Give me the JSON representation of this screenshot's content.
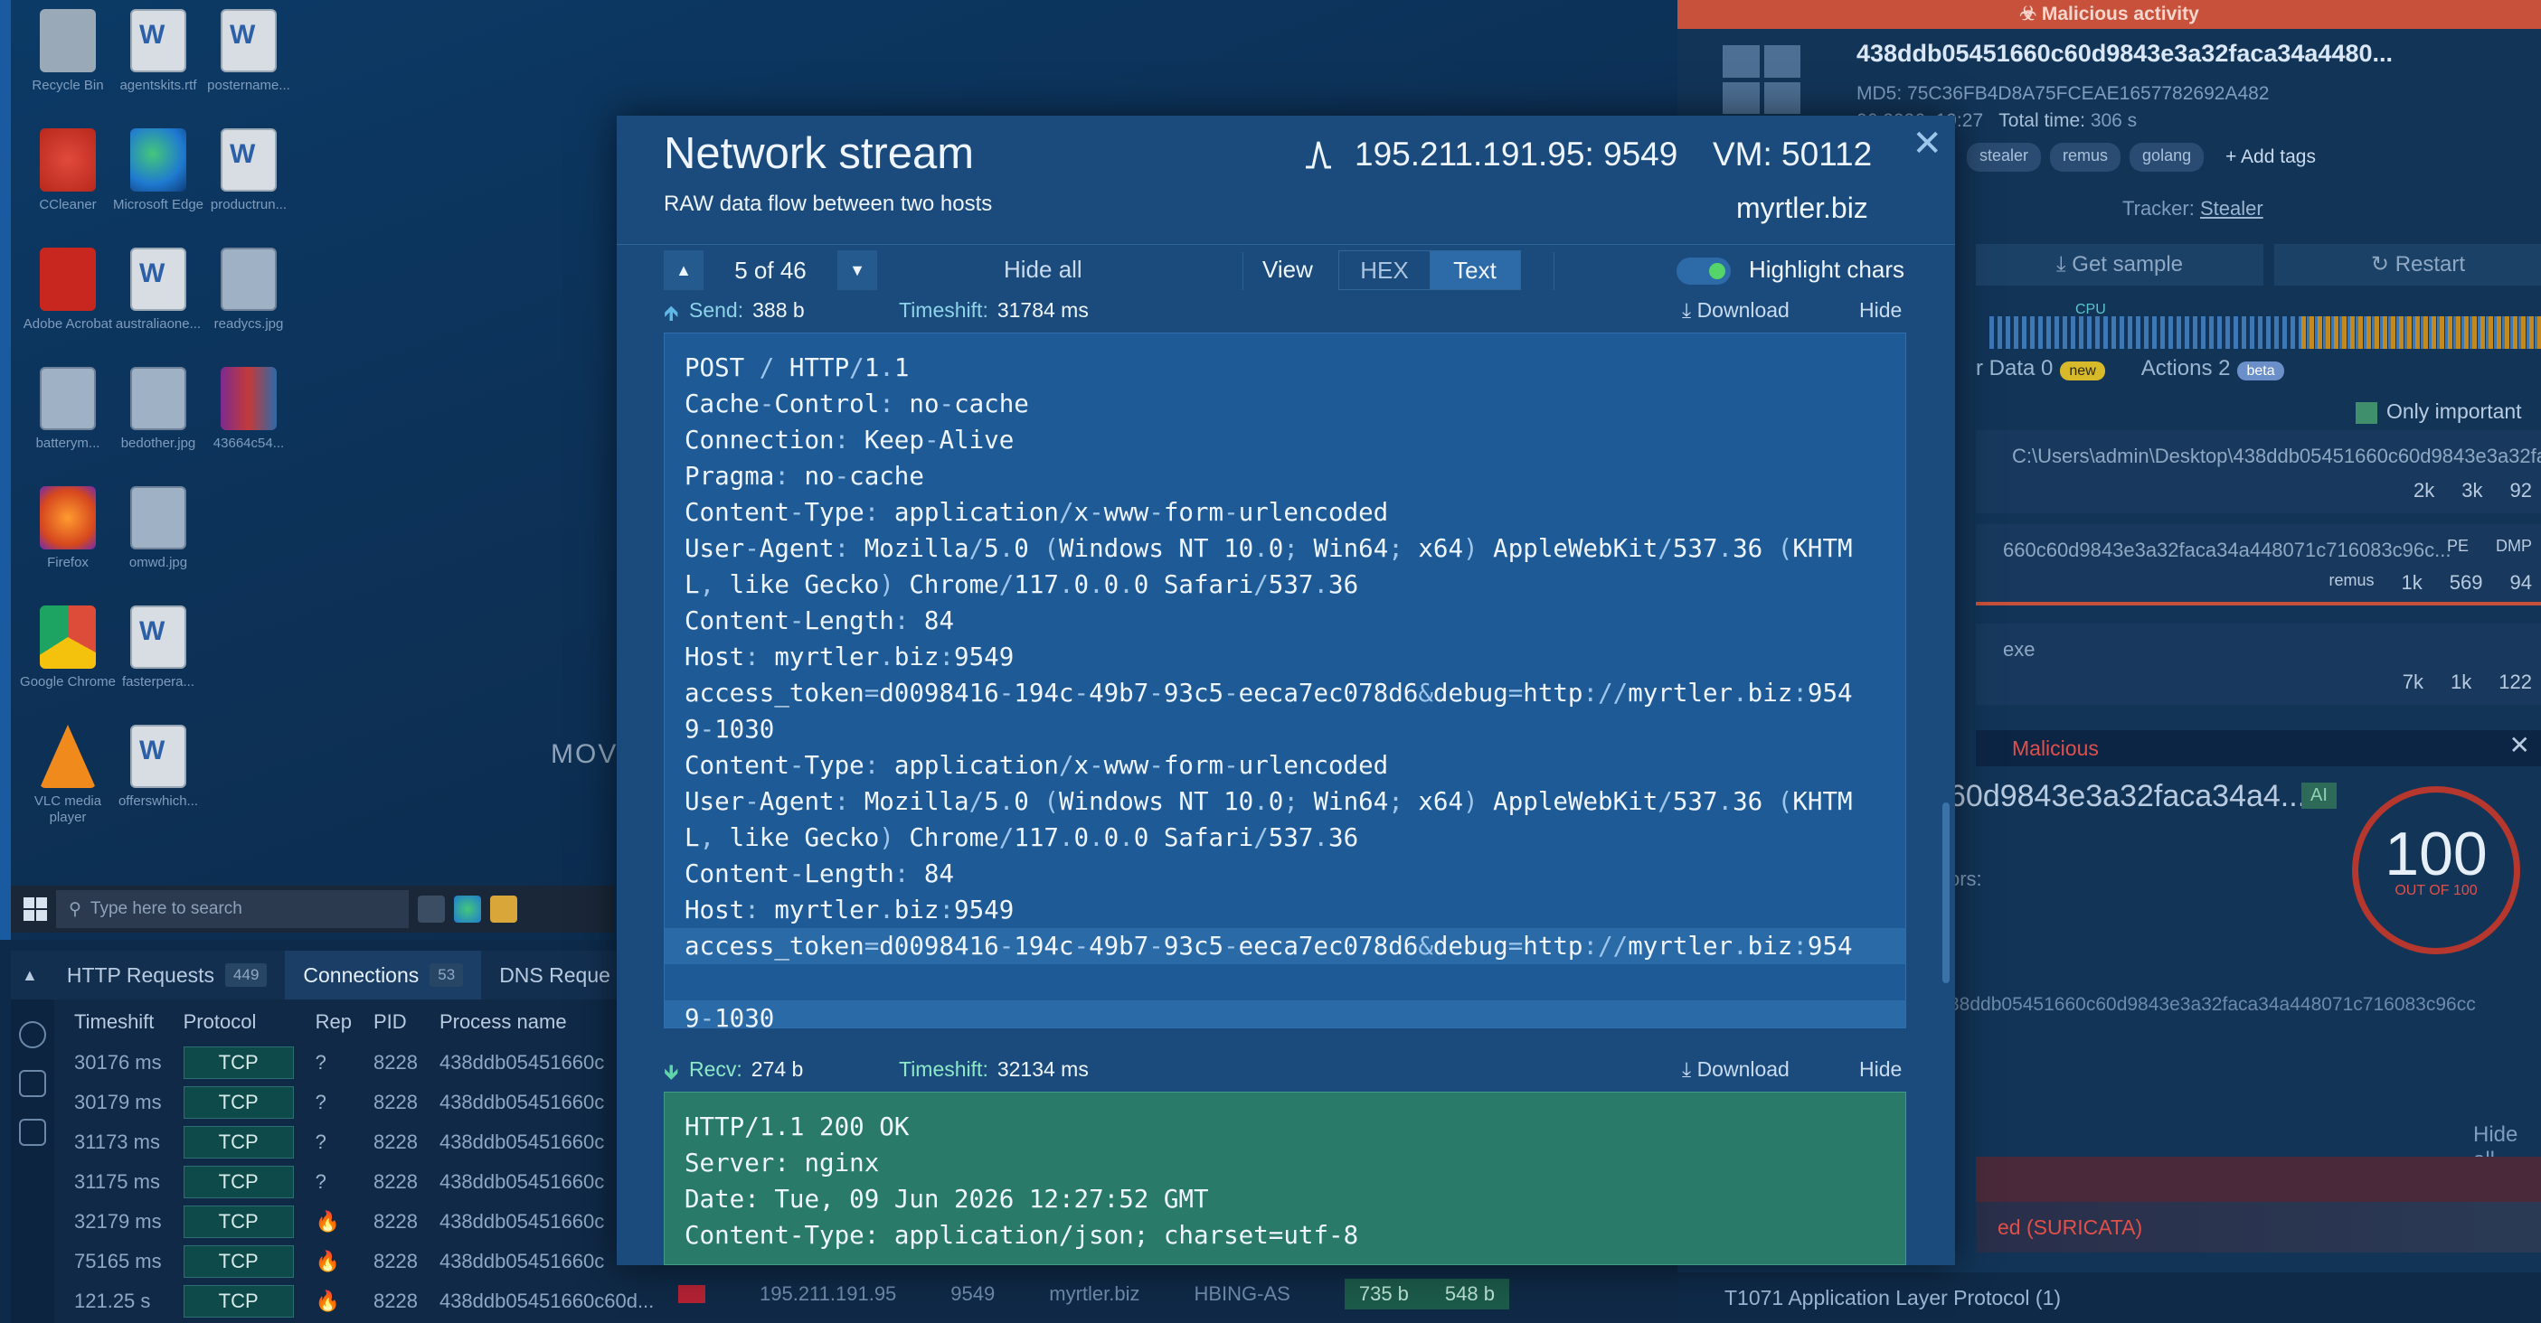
{
  "desktop": {
    "icons": [
      {
        "label": "Recycle Bin",
        "kind": "bin"
      },
      {
        "label": "agentskits.rtf",
        "kind": "word"
      },
      {
        "label": "postername...",
        "kind": "word"
      },
      {
        "label": "CCleaner",
        "kind": "ccl"
      },
      {
        "label": "Microsoft Edge",
        "kind": "edge"
      },
      {
        "label": "productrun...",
        "kind": "word"
      },
      {
        "label": "Adobe Acrobat",
        "kind": "pdf"
      },
      {
        "label": "australiaone...",
        "kind": "word"
      },
      {
        "label": "readycs.jpg",
        "kind": "img"
      },
      {
        "label": "batterym...",
        "kind": "img"
      },
      {
        "label": "bedother.jpg",
        "kind": "img"
      },
      {
        "label": "43664c54...",
        "kind": "rar"
      },
      {
        "label": "Firefox",
        "kind": "ff"
      },
      {
        "label": "omwd.jpg",
        "kind": "img"
      },
      {
        "label": "Google Chrome",
        "kind": "chrome"
      },
      {
        "label": "fasterpera...",
        "kind": "word"
      },
      {
        "label": "VLC media player",
        "kind": "vlc"
      },
      {
        "label": "offerswhich...",
        "kind": "word"
      }
    ],
    "move_text": "MOVE",
    "taskbar_search_placeholder": "Type here to search"
  },
  "connections": {
    "tabs": [
      {
        "label": "HTTP Requests",
        "count": "449"
      },
      {
        "label": "Connections",
        "count": "53"
      },
      {
        "label": "DNS Reque",
        "count": ""
      }
    ],
    "columns": [
      "Timeshift",
      "Protocol",
      "Rep",
      "PID",
      "Process name"
    ],
    "rows": [
      {
        "time": "30176 ms",
        "proto": "TCP",
        "rep": "?",
        "pid": "8228",
        "proc": "438ddb05451660c"
      },
      {
        "time": "30179 ms",
        "proto": "TCP",
        "rep": "?",
        "pid": "8228",
        "proc": "438ddb05451660c"
      },
      {
        "time": "31173 ms",
        "proto": "TCP",
        "rep": "?",
        "pid": "8228",
        "proc": "438ddb05451660c"
      },
      {
        "time": "31175 ms",
        "proto": "TCP",
        "rep": "?",
        "pid": "8228",
        "proc": "438ddb05451660c"
      },
      {
        "time": "32179 ms",
        "proto": "TCP",
        "rep": "fire",
        "pid": "8228",
        "proc": "438ddb05451660c"
      },
      {
        "time": "75165 ms",
        "proto": "TCP",
        "rep": "fire",
        "pid": "8228",
        "proc": "438ddb05451660c"
      },
      {
        "time": "121.25 s",
        "proto": "TCP",
        "rep": "fire",
        "pid": "8228",
        "proc": "438ddb05451660c60d..."
      }
    ],
    "last_row_extra": {
      "ip": "195.211.191.95",
      "port": "9549",
      "domain": "myrtler.biz",
      "asn": "HBING-AS",
      "sent": "735 b",
      "recv": "548 b"
    }
  },
  "analysis": {
    "banner": "Malicious activity",
    "hash": "438ddb05451660c60d9843e3a32faca34a4480...",
    "md5_label": "MD5:",
    "md5": "75C36FB4D8A75FCEAE1657782692A482",
    "start_partial": "06.2026, 19:27",
    "total_time_label": "Total time:",
    "total_time": "306 s",
    "tags": [
      "stealer",
      "remus",
      "golang"
    ],
    "add_tags": "+ Add tags",
    "tracker_label": "Tracker:",
    "tracker_value": "Stealer",
    "get_sample": "Get sample",
    "restart": "Restart",
    "cpu_label": "CPU",
    "data_tab": "r Data",
    "data_count": "0",
    "new_badge": "new",
    "actions_tab": "Actions",
    "actions_count": "2",
    "beta_badge": "beta",
    "only_important": "Only important",
    "proc1_path": "C:\\Users\\admin\\Desktop\\438ddb05451660c60d9843e3a32fa...",
    "proc1_stats": [
      "2k",
      "3k",
      "92"
    ],
    "proc2_name": "660c60d9843e3a32faca34a448071c716083c96c...",
    "proc2_tags": [
      "PE",
      "DMP"
    ],
    "proc2_tag": "remus",
    "proc2_stats": [
      "1k",
      "569",
      "94"
    ],
    "proc3_name": "exe",
    "proc3_stats": [
      "7k",
      "1k",
      "122"
    ],
    "malicious_label": "Malicious",
    "hash_short": "60d9843e3a32faca34a4...",
    "ai_badge": "AI",
    "ors_label": "ors:",
    "score": "100",
    "score_of": "OUT OF 100",
    "hash_full": "38ddb05451660c60d9843e3a32faca34a448071c716083c96cc",
    "hide_all": "Hide all",
    "suricata": "ed (SURICATA)",
    "mitre": "T1071 Application Layer Protocol (1)"
  },
  "modal": {
    "title": "Network stream",
    "subtitle": "RAW data flow between two hosts",
    "endpoint": "195.211.191.95: 9549",
    "vm": "VM: 50112",
    "domain": "myrtler.biz",
    "counter": "5 of 46",
    "hide_all": "Hide all",
    "view_label": "View",
    "view_options": [
      "HEX",
      "Text"
    ],
    "view_selected": "Text",
    "highlight_label": "Highlight chars",
    "highlight_on": true,
    "send": {
      "label": "Send:",
      "size": "388 b",
      "ts_label": "Timeshift:",
      "ts": "31784 ms",
      "download": "Download",
      "hide": "Hide",
      "lines": [
        "POST / HTTP/1.1",
        "Cache-Control: no-cache",
        "Connection: Keep-Alive",
        "Pragma: no-cache",
        "Content-Type: application/x-www-form-urlencoded",
        "User-Agent: Mozilla/5.0 (Windows NT 10.0; Win64; x64) AppleWebKit/537.36 (KHTM",
        "L, like Gecko) Chrome/117.0.0.0 Safari/537.36",
        "Content-Length: 84",
        "Host: myrtler.biz:9549",
        "access_token=d0098416-194c-49b7-93c5-eeca7ec078d6&debug=http://myrtler.biz:954",
        "9-1030",
        "Content-Type: application/x-www-form-urlencoded",
        "User-Agent: Mozilla/5.0 (Windows NT 10.0; Win64; x64) AppleWebKit/537.36 (KHTM",
        "L, like Gecko) Chrome/117.0.0.0 Safari/537.36",
        "Content-Length: 84",
        "Host: myrtler.biz:9549",
        "access_token=d0098416-194c-49b7-93c5-eeca7ec078d6&debug=http://myrtler.biz:954",
        "9-1030"
      ]
    },
    "recv": {
      "label": "Recv:",
      "size": "274 b",
      "ts_label": "Timeshift:",
      "ts": "32134 ms",
      "download": "Download",
      "hide": "Hide",
      "lines": [
        "HTTP/1.1 200 OK",
        "Server: nginx",
        "Date: Tue, 09 Jun 2026 12:27:52 GMT",
        "Content-Type: application/json; charset=utf-8"
      ]
    }
  }
}
